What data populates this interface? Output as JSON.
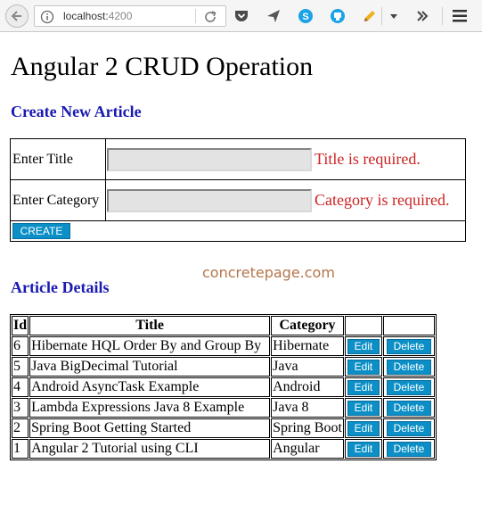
{
  "browser": {
    "url_host": "localhost:",
    "url_port": "4200"
  },
  "page": {
    "title": "Angular 2 CRUD Operation",
    "create_heading": "Create New Article",
    "details_heading": "Article Details",
    "watermark": "concretepage.com"
  },
  "form": {
    "title_label": "Enter Title",
    "title_value": "",
    "title_error": "Title is required.",
    "category_label": "Enter Category",
    "category_value": "",
    "category_error": "Category is required.",
    "create_label": "CREATE"
  },
  "table": {
    "columns": [
      "Id",
      "Title",
      "Category",
      "",
      ""
    ],
    "edit_label": "Edit",
    "delete_label": "Delete",
    "rows": [
      {
        "id": "6",
        "title": "Hibernate HQL Order By and Group By",
        "category": "Hibernate"
      },
      {
        "id": "5",
        "title": "Java BigDecimal Tutorial",
        "category": "Java"
      },
      {
        "id": "4",
        "title": "Android AsyncTask Example",
        "category": "Android"
      },
      {
        "id": "3",
        "title": "Lambda Expressions Java 8 Example",
        "category": "Java 8"
      },
      {
        "id": "2",
        "title": "Spring Boot Getting Started",
        "category": "Spring Boot"
      },
      {
        "id": "1",
        "title": "Angular 2 Tutorial using CLI",
        "category": "Angular"
      }
    ]
  },
  "colors": {
    "heading_blue": "#1a1ab0",
    "error_red": "#cc2222",
    "button_blue": "#0b8fc6",
    "watermark_brown": "#b5754a"
  },
  "icons": [
    "back-arrow-icon",
    "info-icon",
    "reload-icon",
    "pocket-icon",
    "send-icon",
    "skype-icon",
    "bookmark-icon",
    "pencil-icon",
    "dropdown-arrow-icon",
    "overflow-chevrons-icon",
    "hamburger-menu-icon"
  ]
}
